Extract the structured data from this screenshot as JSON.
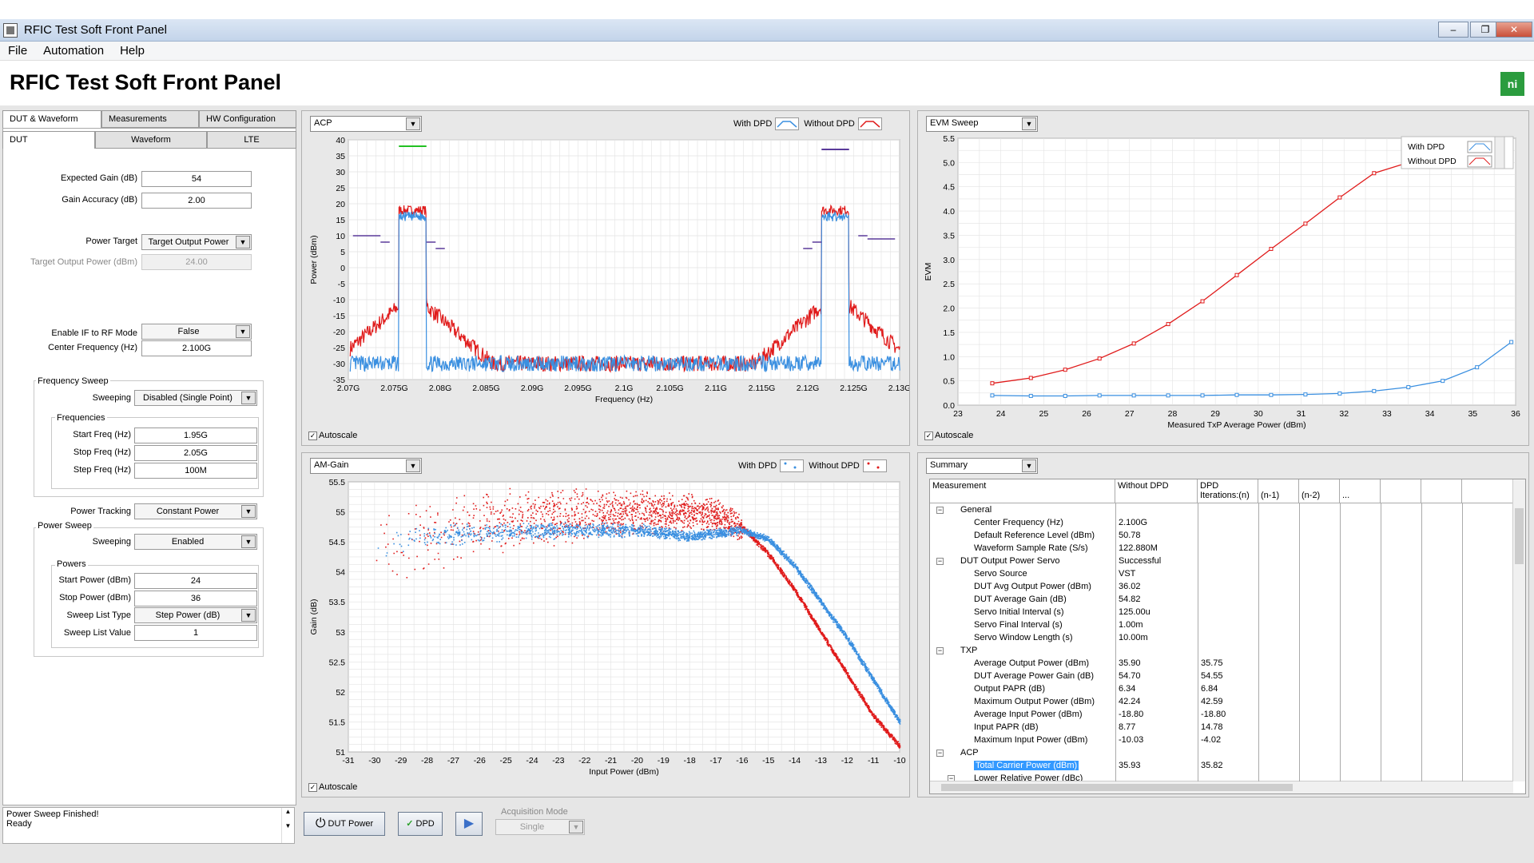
{
  "window": {
    "title": "RFIC Test Soft Front Panel",
    "min": "–",
    "max": "❐",
    "close": "✕"
  },
  "menu": [
    "File",
    "Automation",
    "Help"
  ],
  "header": {
    "title": "RFIC Test Soft Front Panel",
    "logo": "ni"
  },
  "tabs_top": [
    "DUT & Waveform",
    "Measurements",
    "HW Configuration"
  ],
  "tabs_sub": [
    "DUT",
    "Waveform",
    "LTE"
  ],
  "dut": {
    "expected_gain_label": "Expected Gain (dB)",
    "expected_gain": "54",
    "gain_accuracy_label": "Gain Accuracy (dB)",
    "gain_accuracy": "2.00",
    "power_target_label": "Power Target",
    "power_target": "Target Output Power",
    "target_output_label": "Target Output Power (dBm)",
    "target_output": "24.00",
    "enable_if_label": "Enable IF to RF Mode",
    "enable_if": "False",
    "center_freq_label": "Center Frequency (Hz)",
    "center_freq": "2.100G"
  },
  "freq_sweep": {
    "title": "Frequency Sweep",
    "sweeping_label": "Sweeping",
    "sweeping": "Disabled (Single Point)",
    "freqs_title": "Frequencies",
    "start_label": "Start Freq (Hz)",
    "start": "1.95G",
    "stop_label": "Stop Freq (Hz)",
    "stop": "2.05G",
    "step_label": "Step Freq (Hz)",
    "step": "100M"
  },
  "power_tracking": {
    "label": "Power Tracking",
    "value": "Constant Power"
  },
  "power_sweep": {
    "title": "Power Sweep",
    "sweeping_label": "Sweeping",
    "sweeping": "Enabled",
    "powers_title": "Powers",
    "start_label": "Start Power (dBm)",
    "start": "24",
    "stop_label": "Stop Power (dBm)",
    "stop": "36",
    "list_type_label": "Sweep List Type",
    "list_type": "Step Power (dB)",
    "list_value_label": "Sweep List Value",
    "list_value": "1"
  },
  "status": {
    "line1": "Power Sweep Finished!",
    "line2": "Ready"
  },
  "bottom": {
    "dut_power": "DUT Power",
    "dpd": "DPD",
    "acq_label": "Acquisition Mode",
    "acq_value": "Single"
  },
  "legend": {
    "with_dpd": "With DPD",
    "without_dpd": "Without DPD"
  },
  "autoscale": "Autoscale",
  "colors": {
    "with_dpd": "#3a8fe0",
    "without_dpd": "#e01b1b",
    "grid": "#e2e2e2",
    "green_limit": "#22c022",
    "purple_limit": "#5a3a9a"
  },
  "chart_data": [
    {
      "type": "line",
      "selector": "ACP",
      "xlabel": "Frequency (Hz)",
      "ylabel": "Power (dBm)",
      "xlim": [
        2.07,
        2.13
      ],
      "ylim": [
        -35,
        40
      ],
      "x_ticks": [
        "2.07G",
        "2.075G",
        "2.08G",
        "2.085G",
        "2.09G",
        "2.095G",
        "2.1G",
        "2.105G",
        "2.11G",
        "2.115G",
        "2.12G",
        "2.125G",
        "2.13G"
      ],
      "y_ticks": [
        40,
        35,
        30,
        25,
        20,
        15,
        10,
        5,
        0,
        -5,
        -10,
        -15,
        -20,
        -25,
        -30,
        -35
      ],
      "series": [
        {
          "name": "With DPD",
          "shape": "carrier_floor",
          "carriers": [
            [
              2.0755,
              2.0785,
              16
            ],
            [
              2.1215,
              2.1245,
              16
            ]
          ],
          "floor": -30
        },
        {
          "name": "Without DPD",
          "shape": "carrier_skirt",
          "carriers": [
            [
              2.0755,
              2.0785,
              18
            ],
            [
              2.1215,
              2.1245,
              18
            ]
          ],
          "floor": -30
        }
      ]
    },
    {
      "type": "line",
      "selector": "EVM Sweep",
      "xlabel": "Measured TxP Average Power (dBm)",
      "ylabel": "EVM",
      "xlim": [
        23,
        36
      ],
      "ylim": [
        0,
        5.5
      ],
      "y_ticks": [
        5.5,
        5.0,
        4.5,
        4.0,
        3.5,
        3.0,
        2.5,
        2.0,
        1.5,
        1.0,
        0.5,
        0.0
      ],
      "series": [
        {
          "name": "With DPD",
          "x": [
            23.8,
            24.7,
            25.5,
            26.3,
            27.1,
            27.9,
            28.7,
            29.5,
            30.3,
            31.1,
            31.9,
            32.7,
            33.5,
            34.3,
            35.1,
            35.9
          ],
          "y": [
            0.2,
            0.19,
            0.19,
            0.2,
            0.2,
            0.2,
            0.2,
            0.21,
            0.21,
            0.22,
            0.24,
            0.29,
            0.37,
            0.5,
            0.78,
            1.3
          ]
        },
        {
          "name": "Without DPD",
          "x": [
            23.8,
            24.7,
            25.5,
            26.3,
            27.1,
            27.9,
            28.7,
            29.5,
            30.3,
            31.1,
            31.9,
            32.7,
            33.5,
            34.3,
            35.1,
            35.9
          ],
          "y": [
            0.45,
            0.56,
            0.73,
            0.96,
            1.27,
            1.67,
            2.14,
            2.68,
            3.22,
            3.74,
            4.28,
            4.78,
            5.0,
            5.1,
            5.1,
            5.1
          ]
        }
      ]
    },
    {
      "type": "scatter",
      "selector": "AM-Gain",
      "xlabel": "Input Power (dBm)",
      "ylabel": "Gain (dB)",
      "xlim": [
        -31,
        -10
      ],
      "ylim": [
        51,
        55.5
      ],
      "y_ticks": [
        55.5,
        55,
        54.5,
        54,
        53.5,
        53,
        52.5,
        52,
        51.5,
        51
      ],
      "series": [
        {
          "name": "With DPD",
          "trend": [
            [
              -30,
              54.45
            ],
            [
              -28,
              54.6
            ],
            [
              -26,
              54.65
            ],
            [
              -24,
              54.7
            ],
            [
              -22,
              54.7
            ],
            [
              -20,
              54.7
            ],
            [
              -18,
              54.6
            ],
            [
              -16,
              54.7
            ],
            [
              -15,
              54.55
            ],
            [
              -14,
              54.1
            ],
            [
              -13,
              53.5
            ],
            [
              -12,
              52.9
            ],
            [
              -11,
              52.2
            ],
            [
              -10,
              51.5
            ]
          ]
        },
        {
          "name": "Without DPD",
          "trend": [
            [
              -30,
              54.45
            ],
            [
              -28,
              54.6
            ],
            [
              -26,
              54.8
            ],
            [
              -24,
              54.9
            ],
            [
              -22,
              54.95
            ],
            [
              -20,
              55.0
            ],
            [
              -18,
              55.0
            ],
            [
              -17,
              54.95
            ],
            [
              -16,
              54.75
            ],
            [
              -15,
              54.3
            ],
            [
              -14,
              53.7
            ],
            [
              -13,
              53.0
            ],
            [
              -12,
              52.3
            ],
            [
              -11,
              51.6
            ],
            [
              -10,
              51.1
            ]
          ]
        }
      ]
    }
  ],
  "summary": {
    "selector": "Summary",
    "columns": [
      "Measurement",
      "Without DPD",
      "DPD Iterations:(n)",
      "(n-1)",
      "(n-2)",
      "..."
    ],
    "rows": [
      {
        "level": 0,
        "label": "General",
        "exp": "−"
      },
      {
        "level": 1,
        "label": "Center Frequency (Hz)",
        "v1": "2.100G",
        "v2": ""
      },
      {
        "level": 1,
        "label": "Default Reference Level (dBm)",
        "v1": "50.78",
        "v2": ""
      },
      {
        "level": 1,
        "label": "Waveform Sample Rate (S/s)",
        "v1": "122.880M",
        "v2": ""
      },
      {
        "level": 0,
        "label": "DUT Output Power Servo",
        "v1": "Successful",
        "exp": "−"
      },
      {
        "level": 1,
        "label": "Servo Source",
        "v1": "VST",
        "v2": ""
      },
      {
        "level": 1,
        "label": "DUT Avg Output Power (dBm)",
        "v1": "36.02",
        "v2": ""
      },
      {
        "level": 1,
        "label": "DUT Average Gain (dB)",
        "v1": "54.82",
        "v2": ""
      },
      {
        "level": 1,
        "label": "Servo Initial Interval (s)",
        "v1": "125.00u",
        "v2": ""
      },
      {
        "level": 1,
        "label": "Servo Final Interval (s)",
        "v1": "1.00m",
        "v2": ""
      },
      {
        "level": 1,
        "label": "Servo Window Length (s)",
        "v1": "10.00m",
        "v2": ""
      },
      {
        "level": 0,
        "label": "TXP",
        "exp": "−"
      },
      {
        "level": 1,
        "label": "Average Output Power (dBm)",
        "v1": "35.90",
        "v2": "35.75"
      },
      {
        "level": 1,
        "label": "DUT Average Power Gain (dB)",
        "v1": "54.70",
        "v2": "54.55"
      },
      {
        "level": 1,
        "label": "Output PAPR (dB)",
        "v1": "6.34",
        "v2": "6.84"
      },
      {
        "level": 1,
        "label": "Maximum Output Power (dBm)",
        "v1": "42.24",
        "v2": "42.59"
      },
      {
        "level": 1,
        "label": "Average Input Power (dBm)",
        "v1": "-18.80",
        "v2": "-18.80"
      },
      {
        "level": 1,
        "label": "Input PAPR (dB)",
        "v1": "8.77",
        "v2": "14.78"
      },
      {
        "level": 1,
        "label": "Maximum Input Power (dBm)",
        "v1": "-10.03",
        "v2": "-4.02"
      },
      {
        "level": 0,
        "label": "ACP",
        "exp": "−"
      },
      {
        "level": 1,
        "label": "Total Carrier Power (dBm)",
        "v1": "35.93",
        "v2": "35.82",
        "selected": true
      },
      {
        "level": 1,
        "label": "Lower Relative Power (dBc)",
        "v1": "",
        "v2": "",
        "exp": "−"
      }
    ]
  }
}
